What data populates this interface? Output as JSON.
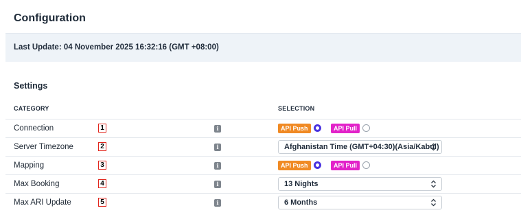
{
  "page": {
    "title": "Configuration",
    "last_update": "Last Update: 04 November 2025 16:32:16 (GMT +08:00)"
  },
  "settings": {
    "title": "Settings",
    "columns": {
      "category": "CATEGORY",
      "selection": "SELECTION"
    },
    "rows": [
      {
        "number": "1",
        "label": "Connection",
        "type": "radio",
        "options": [
          {
            "label": "API Push",
            "selected": true
          },
          {
            "label": "API Pull",
            "selected": false
          }
        ]
      },
      {
        "number": "2",
        "label": "Server Timezone",
        "type": "select",
        "value": "Afghanistan Time (GMT+04:30)(Asia/Kabul)"
      },
      {
        "number": "3",
        "label": "Mapping",
        "type": "radio",
        "options": [
          {
            "label": "API Push",
            "selected": true
          },
          {
            "label": "API Pull",
            "selected": false
          }
        ]
      },
      {
        "number": "4",
        "label": "Max Booking",
        "type": "select",
        "value": "13 Nights"
      },
      {
        "number": "5",
        "label": "Max ARI Update",
        "type": "select",
        "value": "6 Months"
      }
    ]
  },
  "icons": {
    "info": "info-icon",
    "select_arrow": "chevron-updown-icon"
  },
  "colors": {
    "api_push": "#f08a24",
    "api_pull": "#e223c9",
    "radio_selected": "#4b34e0",
    "number_box_border": "#e2261d",
    "header_bar": "#eef3f8"
  }
}
